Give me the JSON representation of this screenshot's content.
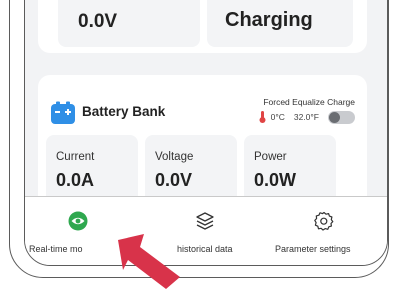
{
  "top_card": {
    "voltage_value": "0.0V",
    "status_value": "Charging"
  },
  "battery_bank": {
    "title": "Battery Bank",
    "forced_equalize_label": "Forced Equalize Charge",
    "temperature_c": "0°C",
    "temperature_f": "32.0°F",
    "forced_equalize_enabled": false,
    "metrics": [
      {
        "label": "Current",
        "value": "0.0A"
      },
      {
        "label": "Voltage",
        "value": "0.0V"
      },
      {
        "label": "Power",
        "value": "0.0W"
      }
    ]
  },
  "tabbar": {
    "tabs": [
      {
        "label": "Real-time mo",
        "icon": "eye-icon",
        "active": true
      },
      {
        "label": "historical data",
        "icon": "layers-icon",
        "active": false
      },
      {
        "label": "Parameter settings",
        "icon": "gear-icon",
        "active": false
      }
    ]
  },
  "colors": {
    "accent_green": "#2fa84f",
    "battery_blue": "#2f8fe6",
    "pointer_red": "#d8334a"
  }
}
